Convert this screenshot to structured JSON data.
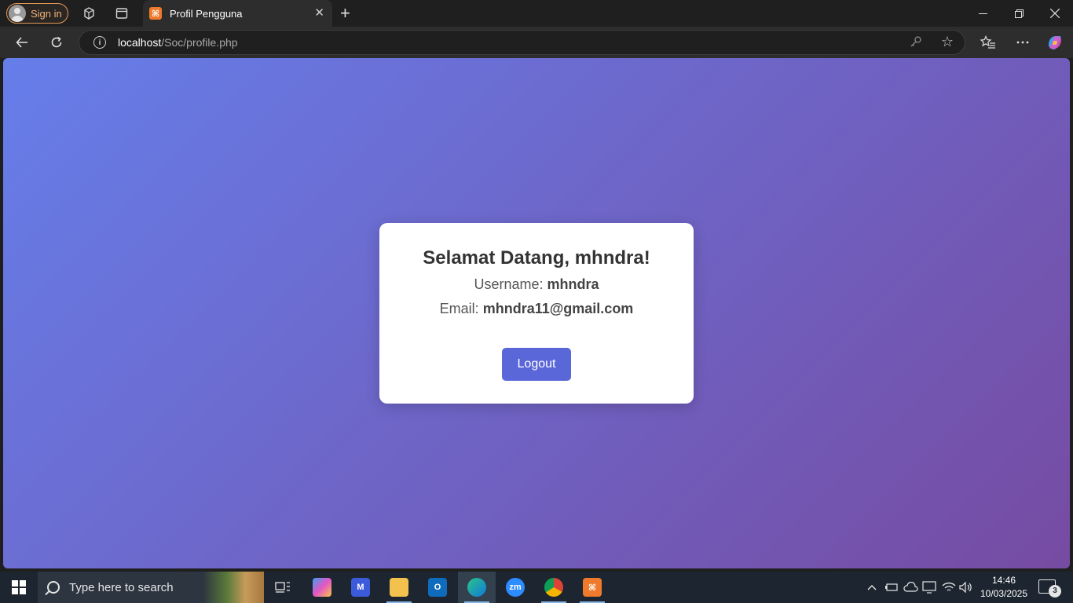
{
  "browser": {
    "signin_label": "Sign in",
    "tab_title": "Profil Pengguna",
    "tab_favicon": "xampp-icon",
    "url_host": "localhost",
    "url_path": "/Soc/profile.php"
  },
  "page": {
    "heading": "Selamat Datang, mhndra!",
    "username_label": "Username:",
    "username_value": "mhndra",
    "email_label": "Email:",
    "email_value": "mhndra11@gmail.com",
    "logout_label": "Logout",
    "gradient_start": "#667eea",
    "gradient_end": "#764ba2",
    "button_color": "#5a67d8"
  },
  "taskbar": {
    "search_placeholder": "Type here to search",
    "time": "14:46",
    "date": "10/03/2025",
    "notification_count": "3"
  }
}
